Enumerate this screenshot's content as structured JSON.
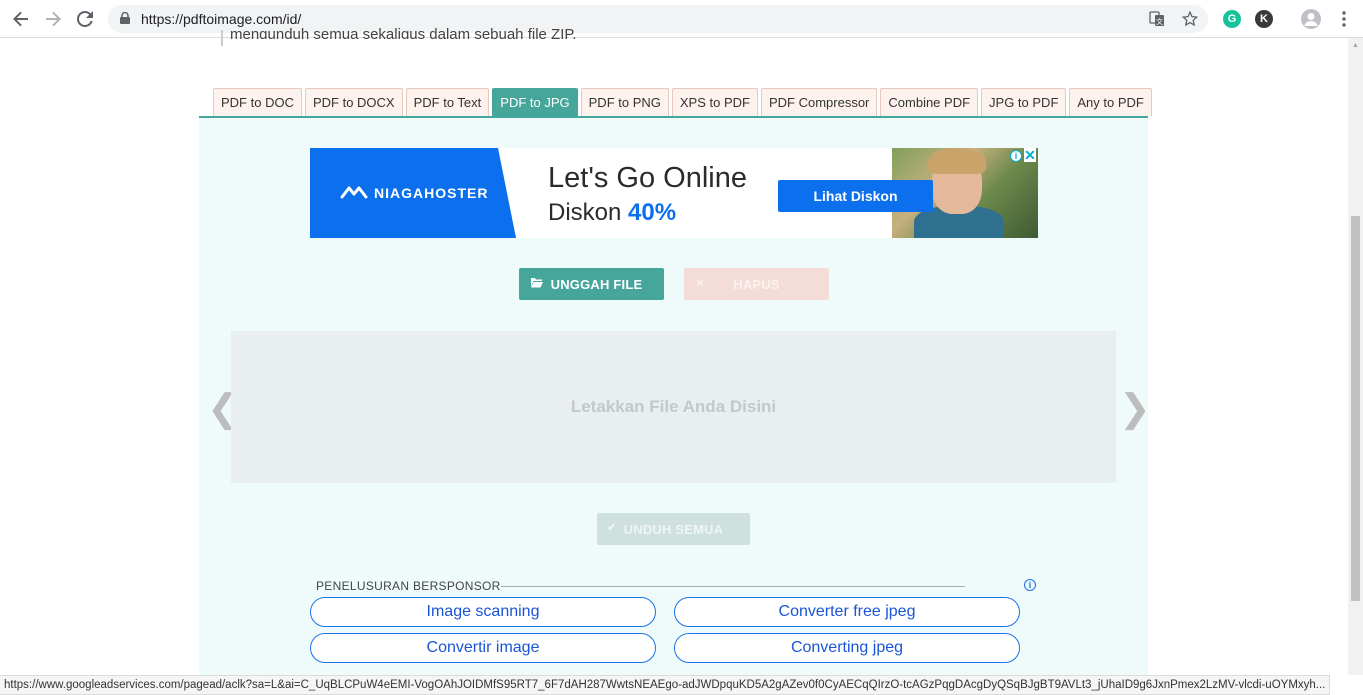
{
  "browser": {
    "url": "https://pdftoimage.com/id/",
    "icons": {
      "back": "back-arrow-icon",
      "forward": "forward-arrow-icon",
      "reload": "reload-icon",
      "lock": "lock-icon",
      "translate": "translate-icon",
      "bookmark": "star-icon",
      "grammarly": "G",
      "extension_k": "K",
      "profile": "profile-icon",
      "menu": "kebab-menu-icon"
    }
  },
  "page": {
    "cut_text": "mengunduh semua sekaligus dalam sebuah file ZIP."
  },
  "tabs": [
    {
      "label": "PDF to DOC",
      "active": false
    },
    {
      "label": "PDF to DOCX",
      "active": false
    },
    {
      "label": "PDF to Text",
      "active": false
    },
    {
      "label": "PDF to JPG",
      "active": true
    },
    {
      "label": "PDF to PNG",
      "active": false
    },
    {
      "label": "XPS to PDF",
      "active": false
    },
    {
      "label": "PDF Compressor",
      "active": false
    },
    {
      "label": "Combine PDF",
      "active": false
    },
    {
      "label": "JPG to PDF",
      "active": false
    },
    {
      "label": "Any to PDF",
      "active": false
    }
  ],
  "ad": {
    "brand": "NIAGAHOSTER",
    "headline": "Let's Go Online",
    "sub_prefix": "Diskon",
    "sub_highlight": "40%",
    "cta": "Lihat Diskon",
    "info_glyph": "i",
    "close_glyph": "✕"
  },
  "actions": {
    "upload_label": "UNGGAH FILE",
    "delete_label": "HAPUS",
    "download_all_label": "UNDUH SEMUA",
    "delete_icon": "×",
    "download_icon": "✔"
  },
  "dropzone": {
    "text": "Letakkan File Anda Disini",
    "prev": "❮",
    "next": "❯"
  },
  "sponsored": {
    "label": "PENELUSURAN BERSPONSOR",
    "info_glyph": "i",
    "links": [
      "Image scanning",
      "Converter free jpeg",
      "Convertir image",
      "Converting jpeg"
    ]
  },
  "status_bar": {
    "text": "https://www.googleadservices.com/pagead/aclk?sa=L&ai=C_UqBLCPuW4eEMI-VogOAhJOIDMfS95RT7_6F7dAH287WwtsNEAEgo-adJWDpquKD5A2gAZev0f0CyAECqQIrzO-tcAGzPqgDAcgDyQSqBJgBT9AVLt3_jUhaID9g6JxnPmex2LzMV-vlcdi-uOYMxyh..."
  },
  "colors": {
    "accent": "#47a69b",
    "panel": "#effafb",
    "ad_blue": "#0c6fee",
    "link_blue": "#1a73e8"
  }
}
